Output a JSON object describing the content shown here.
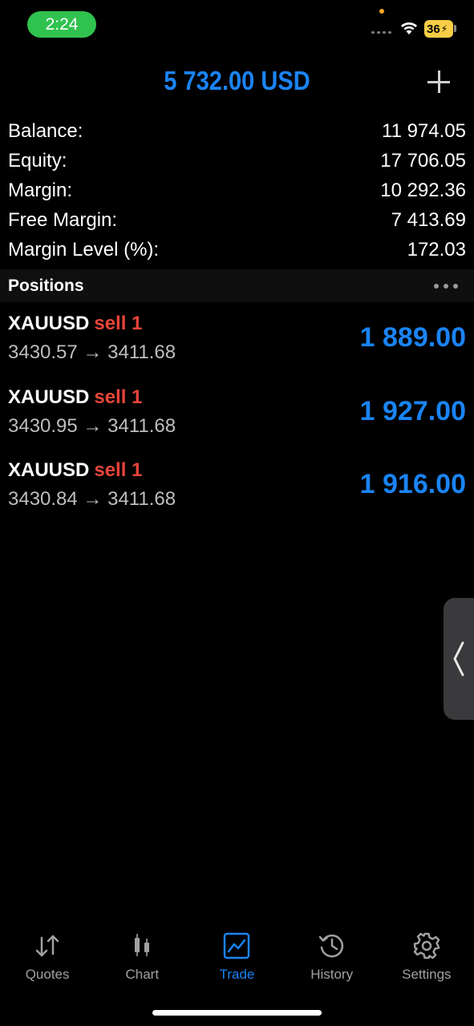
{
  "status": {
    "time": "2:24",
    "battery": "36"
  },
  "header": {
    "title": "5 732.00 USD"
  },
  "summary": [
    {
      "label": "Balance:",
      "value": "11 974.05"
    },
    {
      "label": "Equity:",
      "value": "17 706.05"
    },
    {
      "label": "Margin:",
      "value": "10 292.36"
    },
    {
      "label": "Free Margin:",
      "value": "7 413.69"
    },
    {
      "label": "Margin Level (%):",
      "value": "172.03"
    }
  ],
  "positions_header": {
    "title": "Positions"
  },
  "positions": [
    {
      "symbol": "XAUUSD",
      "side": "sell 1",
      "prices": "3430.57 → 3411.68",
      "profit": "1 889.00"
    },
    {
      "symbol": "XAUUSD",
      "side": "sell 1",
      "prices": "3430.95 → 3411.68",
      "profit": "1 927.00"
    },
    {
      "symbol": "XAUUSD",
      "side": "sell 1",
      "prices": "3430.84 → 3411.68",
      "profit": "1 916.00"
    }
  ],
  "tabs": [
    {
      "label": "Quotes",
      "icon": "quotes-icon",
      "active": false
    },
    {
      "label": "Chart",
      "icon": "chart-icon",
      "active": false
    },
    {
      "label": "Trade",
      "icon": "trade-icon",
      "active": true
    },
    {
      "label": "History",
      "icon": "history-icon",
      "active": false
    },
    {
      "label": "Settings",
      "icon": "settings-icon",
      "active": false
    }
  ],
  "colors": {
    "accent": "#1a84f5",
    "sell": "#e8453a",
    "time_pill": "#30c24f",
    "battery": "#f7ce46"
  }
}
